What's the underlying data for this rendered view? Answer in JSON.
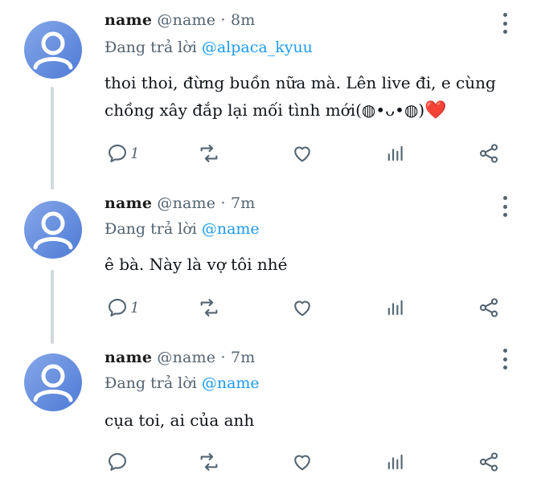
{
  "colors": {
    "accent": "#1d9bf0",
    "muted": "#536471",
    "text": "#0f1419",
    "heart": "#e0245e"
  },
  "tweets": [
    {
      "display_name": "name",
      "handle": "@name",
      "separator": "·",
      "time": "8m",
      "reply_prefix": "Đang trả lời",
      "reply_to": "@alpaca_kyuu",
      "text": "thoi thoi, đừng buồn nữa mà. Lên live đi, e cùng chồng xây đắp lại mối tình mới(◍•ᴗ•◍)",
      "emoji": "❤️",
      "reply_count": "1",
      "icons": [
        "comment-icon",
        "retweet-icon",
        "like-icon",
        "analytics-icon",
        "share-icon",
        "more-icon"
      ]
    },
    {
      "display_name": "name",
      "handle": "@name",
      "separator": "·",
      "time": "7m",
      "reply_prefix": "Đang trả lời",
      "reply_to": "@name",
      "text": "ê bà. Này là vợ tôi nhé",
      "emoji": "",
      "reply_count": "1",
      "icons": [
        "comment-icon",
        "retweet-icon",
        "like-icon",
        "analytics-icon",
        "share-icon",
        "more-icon"
      ]
    },
    {
      "display_name": "name",
      "handle": "@name",
      "separator": "·",
      "time": "7m",
      "reply_prefix": "Đang trả lời",
      "reply_to": "@name",
      "text": "cụa toi, ai của anh",
      "emoji": "",
      "reply_count": "",
      "icons": [
        "comment-icon",
        "retweet-icon",
        "like-icon",
        "analytics-icon",
        "share-icon",
        "more-icon"
      ]
    }
  ]
}
